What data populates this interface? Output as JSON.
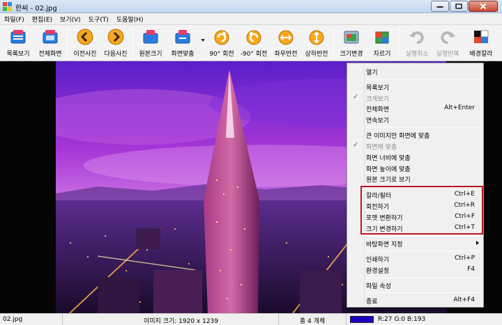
{
  "window": {
    "title": "한씨 - 02.jpg"
  },
  "menubar": {
    "items": [
      "파일(F)",
      "편집(E)",
      "보기(V)",
      "도구(T)",
      "도움말(H)"
    ]
  },
  "toolbar": {
    "buttons": [
      {
        "label": "목록보기",
        "icon": "list-view-icon"
      },
      {
        "label": "전체화면",
        "icon": "fullscreen-icon"
      },
      {
        "label": "이전사진",
        "icon": "prev-arrow-icon"
      },
      {
        "label": "다음사진",
        "icon": "next-arrow-icon"
      },
      {
        "label": "원본크기",
        "icon": "original-size-icon"
      },
      {
        "label": "화면맞춤",
        "icon": "fit-screen-icon"
      },
      {
        "label": "90° 회전",
        "icon": "rotate-cw-icon"
      },
      {
        "label": "-90° 회전",
        "icon": "rotate-ccw-icon"
      },
      {
        "label": "좌우반전",
        "icon": "flip-horizontal-icon"
      },
      {
        "label": "상하반전",
        "icon": "flip-vertical-icon"
      },
      {
        "label": "크기변경",
        "icon": "resize-icon"
      },
      {
        "label": "자르기",
        "icon": "crop-icon"
      },
      {
        "label": "실행취소",
        "icon": "undo-icon",
        "disabled": true
      },
      {
        "label": "실행반복",
        "icon": "redo-icon",
        "disabled": true
      },
      {
        "label": "배경칼라",
        "icon": "background-color-icon"
      }
    ]
  },
  "context_menu": {
    "items": [
      {
        "label": "열기"
      },
      {
        "label": "목록보기"
      },
      {
        "label": "크게보기",
        "checked": true,
        "disabled": true
      },
      {
        "label": "전체화면",
        "shortcut": "Alt+Enter"
      },
      {
        "label": "연속보기"
      },
      {
        "label": "큰 이미지만 화면에 맞춤"
      },
      {
        "label": "화면에 맞춤",
        "checked": true,
        "disabled": true
      },
      {
        "label": "화면 너비에 맞춤"
      },
      {
        "label": "화면 높이에 맞춤"
      },
      {
        "label": "원본 크기로 보기"
      },
      {
        "label": "칼라/필터",
        "shortcut": "Ctrl+E"
      },
      {
        "label": "회전하기",
        "shortcut": "Ctrl+R"
      },
      {
        "label": "포맷 변환하기",
        "shortcut": "Ctrl+F"
      },
      {
        "label": "크기 변경하기",
        "shortcut": "Ctrl+T"
      },
      {
        "label": "바탕화면 지정"
      },
      {
        "label": "인쇄하기",
        "shortcut": "Ctrl+P"
      },
      {
        "label": "환경설정",
        "shortcut": "F4"
      },
      {
        "label": "파일 속성"
      },
      {
        "label": "종료",
        "shortcut": "Alt+F4"
      }
    ]
  },
  "statusbar": {
    "filename": "02.jpg",
    "image_size": "이미지 크기: 1920 x 1239",
    "count": "총 4 개체",
    "color_value": "R:27 G:0 B:193",
    "swatch_color": "#1b00c1"
  },
  "colors": {
    "highlight": "#c0141e",
    "menu_bg": "#f0f0f0"
  }
}
